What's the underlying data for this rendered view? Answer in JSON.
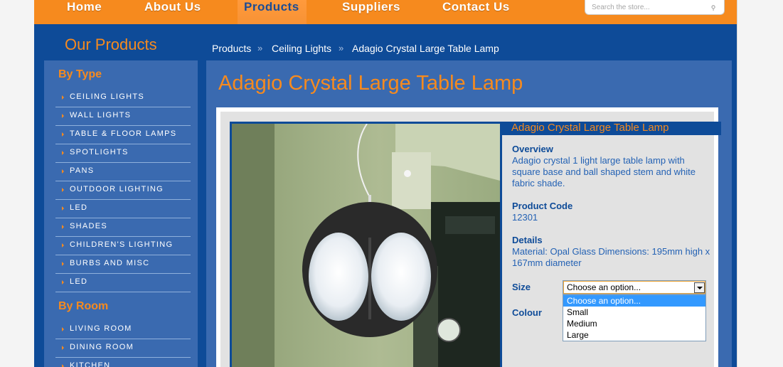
{
  "nav": {
    "items": [
      {
        "label": "Home"
      },
      {
        "label": "About Us"
      },
      {
        "label": "Products"
      },
      {
        "label": "Suppliers"
      },
      {
        "label": "Contact Us"
      }
    ],
    "active": "Products",
    "search_placeholder": "Search the store..."
  },
  "section_title": "Our Products",
  "sidebar": {
    "by_type_heading": "By Type",
    "type_items": [
      {
        "label": "CEILING LIGHTS"
      },
      {
        "label": "WALL LIGHTS"
      },
      {
        "label": "TABLE & FLOOR LAMPS"
      },
      {
        "label": "SPOTLIGHTS"
      },
      {
        "label": "PANS"
      },
      {
        "label": "OUTDOOR LIGHTING"
      },
      {
        "label": "LED"
      },
      {
        "label": "SHADES"
      },
      {
        "label": "CHILDREN'S LIGHTING"
      },
      {
        "label": "BURBS AND MISC"
      },
      {
        "label": "LED"
      }
    ],
    "by_room_heading": "By Room",
    "room_items": [
      {
        "label": "LIVING ROOM"
      },
      {
        "label": "DINING ROOM"
      },
      {
        "label": "KITCHEN"
      }
    ]
  },
  "breadcrumb": {
    "items": [
      "Products",
      "Ceiling Lights",
      "Adagio Crystal Large Table Lamp"
    ],
    "separator": "»"
  },
  "product": {
    "title": "Adagio Crystal Large Table Lamp",
    "panel_title": "Adagio Crystal Large Table Lamp",
    "overview_label": "Overview",
    "overview_text": "Adagio crystal 1 light large table lamp with square base and ball shaped stem and white fabric shade.",
    "code_label": "Product Code",
    "code_value": "12301",
    "details_label": "Details",
    "details_text": "Material: Opal Glass Dimensions: 195mm high x 167mm diameter",
    "size_label": "Size",
    "colour_label": "Colour",
    "size_select": {
      "selected": "Choose an option...",
      "options": [
        "Choose an option...",
        "Small",
        "Medium",
        "Large"
      ],
      "highlighted": "Choose an option..."
    }
  },
  "colors": {
    "orange": "#f68a1e",
    "navy": "#0e4b98",
    "mid_blue": "#3a6ab0",
    "text_blue": "#2462b4"
  }
}
